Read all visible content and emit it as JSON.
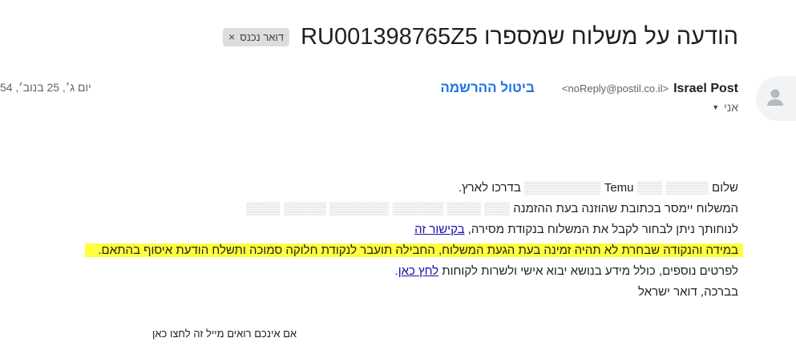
{
  "email": {
    "subject": "הודעה על משלוח שמספרו RU001398765Z5",
    "label": "דואר נכנס",
    "label_close": "×",
    "sender_name": "Israel Post",
    "sender_email": "<noReply@postil.co.il>",
    "unsubscribe": "ביטול ההרשמה",
    "date": "יום ג׳, 25 בנוב׳, 54",
    "to": "אני",
    "to_caret": "▼"
  },
  "body": {
    "line1_start": "שלום ",
    "line1_mid": "Temu",
    "line1_end": " בדרכו לארץ.",
    "line2": "המשלוח יימסר בכתובת שהוזנה בעת ההזמנה",
    "line3_text": "לנוחותך ניתן לבחור לקבל את המשלוח בנקודת מסירה, ",
    "line3_link": "בקישור זה",
    "line4": "במידה והנקודה שבחרת לא תהיה זמינה בעת הגעת המשלוח, החבילה תועבר לנקודת חלוקה סמוכה ותשלח הודעת איסוף בהתאם.",
    "line5_text": "לפרטים נוספים, כולל מידע בנושא יבוא אישי ולשרות לקוחות ",
    "line5_link": "לחץ כאן",
    "line5_end": ".",
    "line6": "בברכה, דואר ישראל"
  },
  "footer": {
    "text": "אם אינכם רואים מייל זה לחצו כאן"
  },
  "colors": {
    "highlight": "#ffff3c",
    "link": "#1a73e8"
  }
}
